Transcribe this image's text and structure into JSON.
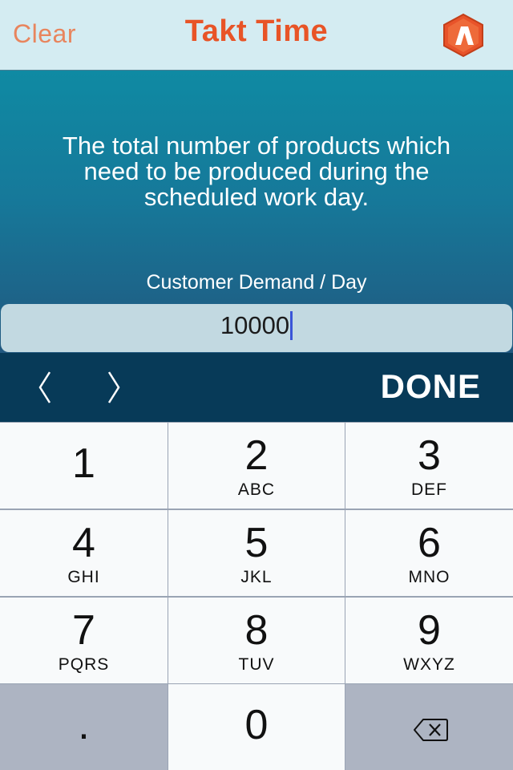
{
  "nav": {
    "clear_label": "Clear",
    "title": "Takt Time",
    "logo_icon": "app-logo-icon"
  },
  "main": {
    "description": "The total number of products which need to be produced during the scheduled work day.",
    "field_label": "Customer Demand / Day",
    "field_value": "10000"
  },
  "accessory": {
    "prev_icon": "chevron-left-icon",
    "next_icon": "chevron-right-icon",
    "done_label": "DONE"
  },
  "keypad": {
    "keys": [
      {
        "num": "1",
        "letters": ""
      },
      {
        "num": "2",
        "letters": "ABC"
      },
      {
        "num": "3",
        "letters": "DEF"
      },
      {
        "num": "4",
        "letters": "GHI"
      },
      {
        "num": "5",
        "letters": "JKL"
      },
      {
        "num": "6",
        "letters": "MNO"
      },
      {
        "num": "7",
        "letters": "PQRS"
      },
      {
        "num": "8",
        "letters": "TUV"
      },
      {
        "num": "9",
        "letters": "WXYZ"
      },
      {
        "num": ".",
        "letters": ""
      },
      {
        "num": "0",
        "letters": ""
      }
    ],
    "backspace_icon": "backspace-icon"
  },
  "colors": {
    "accent": "#e85427",
    "nav_bg": "#d4ecf2",
    "accessory_bg": "#073a58"
  }
}
